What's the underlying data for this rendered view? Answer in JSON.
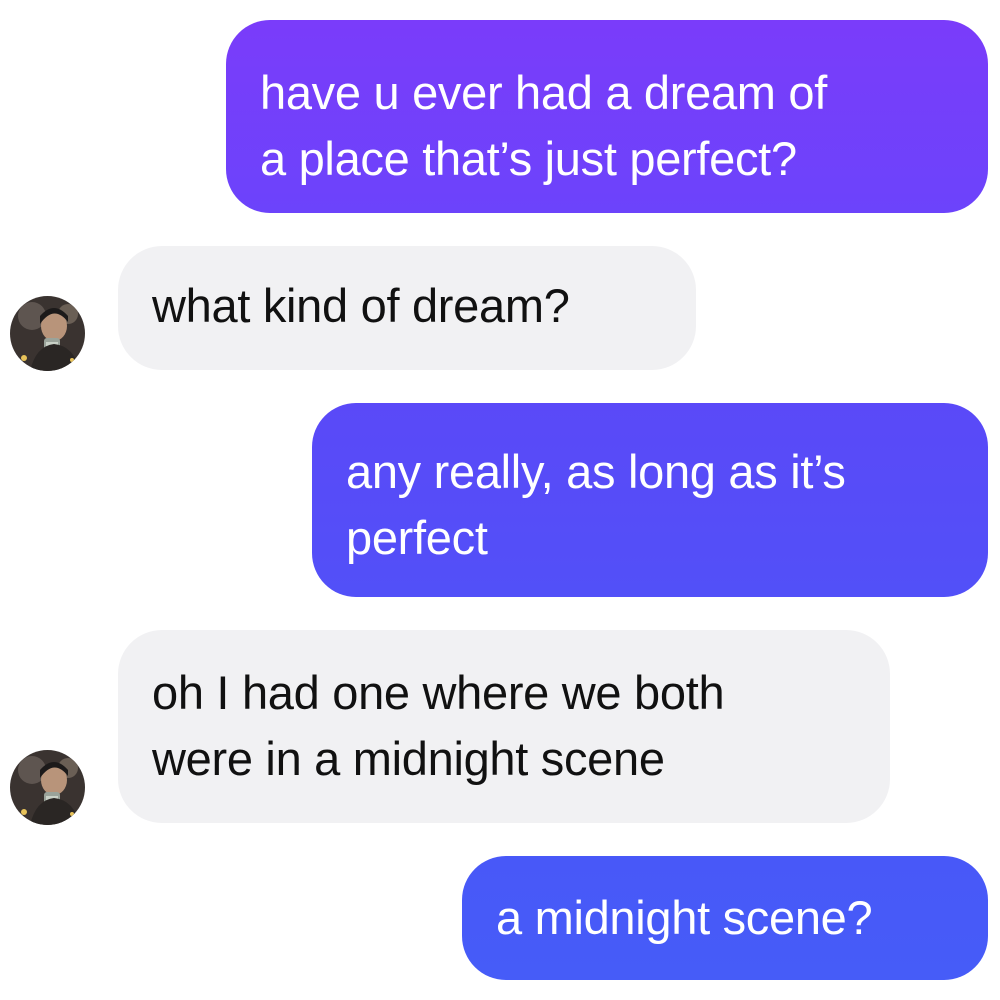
{
  "messages": [
    {
      "sender": "me",
      "lines": [
        "have u ever had a dream of",
        "a place that’s just perfect?"
      ]
    },
    {
      "sender": "other",
      "lines": [
        "what kind of dream?"
      ]
    },
    {
      "sender": "me",
      "lines": [
        "any really, as long as it’s",
        "perfect"
      ]
    },
    {
      "sender": "other",
      "lines": [
        "oh I had one where we both",
        "were in a midnight scene"
      ]
    },
    {
      "sender": "me",
      "lines": [
        "a midnight scene?"
      ]
    }
  ],
  "colors": {
    "outgoing_top": "#7a3cfa",
    "outgoing_bottom": "#465cf8",
    "incoming_bubble": "#f1f1f3",
    "incoming_text": "#111111",
    "outgoing_text": "#ffffff",
    "background": "#ffffff"
  },
  "icons": {
    "avatar": "contact-avatar-photo"
  }
}
